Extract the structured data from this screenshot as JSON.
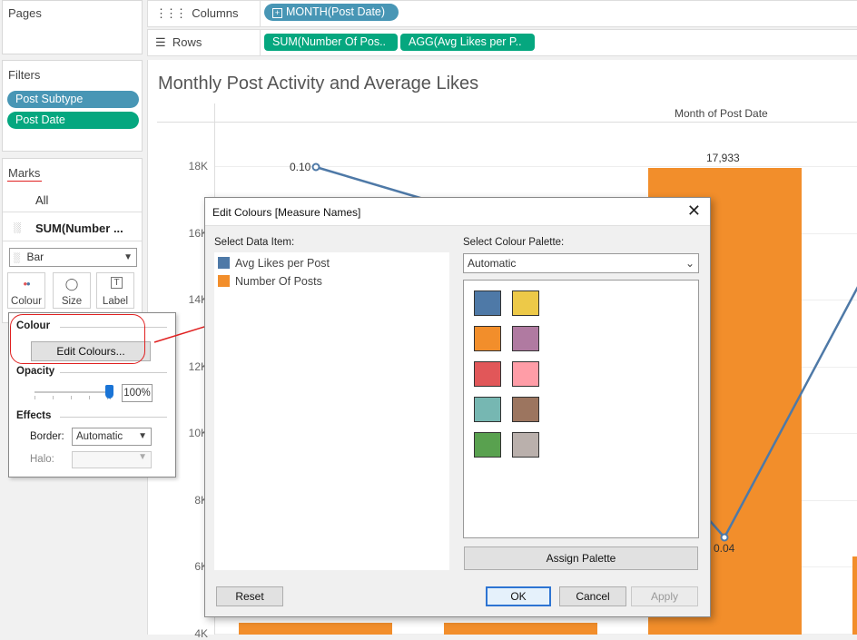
{
  "left_panel": {
    "pages_title": "Pages",
    "filters_title": "Filters",
    "filters": [
      {
        "label": "Post Subtype",
        "color": "#4896b5"
      },
      {
        "label": "Post Date",
        "color": "#05a77f"
      }
    ],
    "marks_title": "Marks",
    "marks_all": "All",
    "marks_measure": "SUM(Number ...",
    "mark_type": "Bar",
    "mark_buttons": {
      "colour": "Colour",
      "size": "Size",
      "label": "Label"
    }
  },
  "shelves": {
    "columns_label": "Columns",
    "columns_pills": [
      "MONTH(Post Date)"
    ],
    "rows_label": "Rows",
    "rows_pills": [
      "SUM(Number Of Pos..",
      "AGG(Avg Likes per P.."
    ]
  },
  "colour_popup": {
    "colour_title": "Colour",
    "edit_button": "Edit Colours...",
    "opacity_title": "Opacity",
    "opacity_value": "100%",
    "opacity_fraction": 1.0,
    "effects_title": "Effects",
    "border_label": "Border:",
    "border_value": "Automatic",
    "halo_label": "Halo:",
    "halo_value": ""
  },
  "chart": {
    "title": "Monthly Post Activity and Average Likes",
    "column_header": "Month of Post Date",
    "accent_bar": "#f28e2b",
    "accent_line": "#4e79a7"
  },
  "chart_data": {
    "type": "bar",
    "y_ticks": [
      "18K",
      "16K",
      "14K",
      "12K",
      "10K",
      "8K",
      "6K",
      "4K"
    ],
    "y_tick_values": [
      18000,
      16000,
      14000,
      12000,
      10000,
      8000,
      6000,
      4000
    ],
    "ylim": [
      4000,
      18000
    ],
    "bar_values": [
      4300,
      4300,
      17933,
      6300
    ],
    "bar_labels": [
      "",
      "",
      "17,933",
      ""
    ],
    "line_values": [
      0.1,
      null,
      0.04,
      null
    ],
    "line_labels": [
      "0.10",
      "",
      "0.04",
      ""
    ]
  },
  "dialog": {
    "title": "Edit Colours [Measure Names]",
    "select_data_item": "Select Data Item:",
    "items": [
      {
        "label": "Avg Likes per Post",
        "color": "#4e79a7"
      },
      {
        "label": "Number Of Posts",
        "color": "#f28e2b"
      }
    ],
    "select_palette": "Select Colour Palette:",
    "palette_value": "Automatic",
    "palette_colors": [
      "#4e79a7",
      "#edc948",
      "#f28e2b",
      "#b07aa1",
      "#e15759",
      "#ff9da7",
      "#76b7b2",
      "#9c755f",
      "#59a14f",
      "#bab0ac"
    ],
    "assign_button": "Assign Palette",
    "reset_button": "Reset",
    "ok_button": "OK",
    "cancel_button": "Cancel",
    "apply_button": "Apply"
  }
}
